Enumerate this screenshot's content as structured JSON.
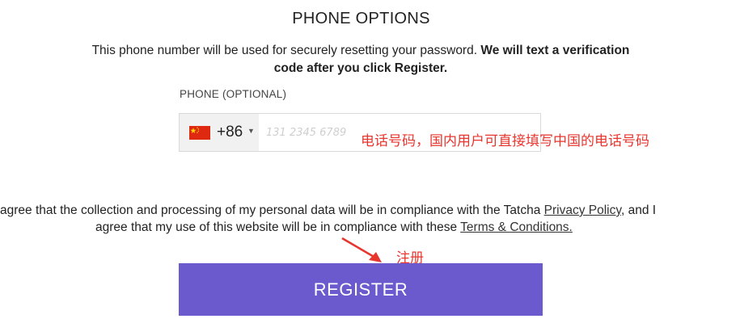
{
  "section_title": "PHONE OPTIONS",
  "description": {
    "plain": "This phone number will be used for securely resetting your password. ",
    "bold": "We will text a verification code after you click Register."
  },
  "phone": {
    "label": "PHONE (OPTIONAL)",
    "country_code": "+86",
    "flag": "china-flag-icon",
    "value": "",
    "placeholder": "131 2345 6789"
  },
  "annotations": {
    "phone_note": "电话号码，国内用户可直接填写中国的电话号码",
    "register_note": "注册",
    "color": "#e8362f"
  },
  "consent": {
    "part1": "agree that the collection and processing of my personal data will be in compliance with the Tatcha ",
    "privacy_link": "Privacy Policy",
    "part2": ", and I",
    "part3": "agree that my use of this website will be in compliance with these ",
    "terms_link": "Terms & Conditions."
  },
  "register_button": {
    "label": "REGISTER",
    "color": "#6a5acd"
  }
}
